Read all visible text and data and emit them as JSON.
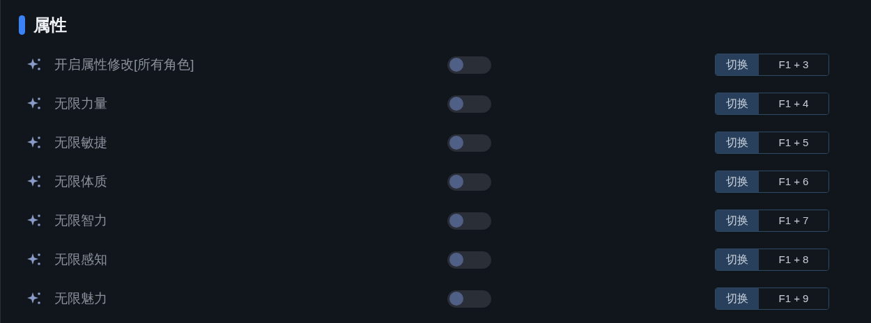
{
  "section": {
    "title": "属性"
  },
  "rows": [
    {
      "label": "开启属性修改[所有角色]",
      "on": false,
      "action": "切换",
      "hotkey": "F1 + 3"
    },
    {
      "label": "无限力量",
      "on": false,
      "action": "切换",
      "hotkey": "F1 + 4"
    },
    {
      "label": "无限敏捷",
      "on": false,
      "action": "切换",
      "hotkey": "F1 + 5"
    },
    {
      "label": "无限体质",
      "on": false,
      "action": "切换",
      "hotkey": "F1 + 6"
    },
    {
      "label": "无限智力",
      "on": false,
      "action": "切换",
      "hotkey": "F1 + 7"
    },
    {
      "label": "无限感知",
      "on": false,
      "action": "切换",
      "hotkey": "F1 + 8"
    },
    {
      "label": "无限魅力",
      "on": false,
      "action": "切换",
      "hotkey": "F1 + 9"
    }
  ]
}
